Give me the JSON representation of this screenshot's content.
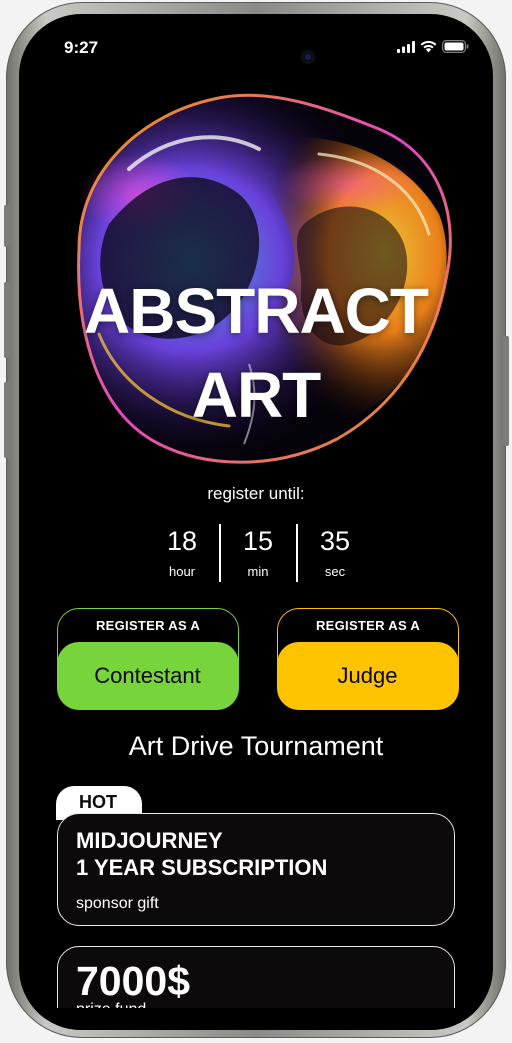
{
  "status_bar": {
    "time": "9:27"
  },
  "hero": {
    "title_line1": "ABSTRACT",
    "title_line2": "ART"
  },
  "countdown": {
    "caption": "register until:",
    "items": [
      {
        "value": "18",
        "unit": "hour"
      },
      {
        "value": "15",
        "unit": "min"
      },
      {
        "value": "35",
        "unit": "sec"
      }
    ]
  },
  "register": {
    "contestant": {
      "prefix": "REGISTER AS A",
      "label": "Contestant",
      "color": "#77d43a"
    },
    "judge": {
      "prefix": "REGISTER AS A",
      "label": "Judge",
      "color": "#ffc300"
    }
  },
  "tournament": {
    "title": "Art Drive Tournament",
    "hot_badge": "HOT",
    "prizes": [
      {
        "headline": "MIDJOURNEY\n1 YEAR SUBSCRIPTION",
        "subtitle": "sponsor gift"
      },
      {
        "headline": "7000$",
        "subtitle": "prize fund"
      }
    ]
  }
}
